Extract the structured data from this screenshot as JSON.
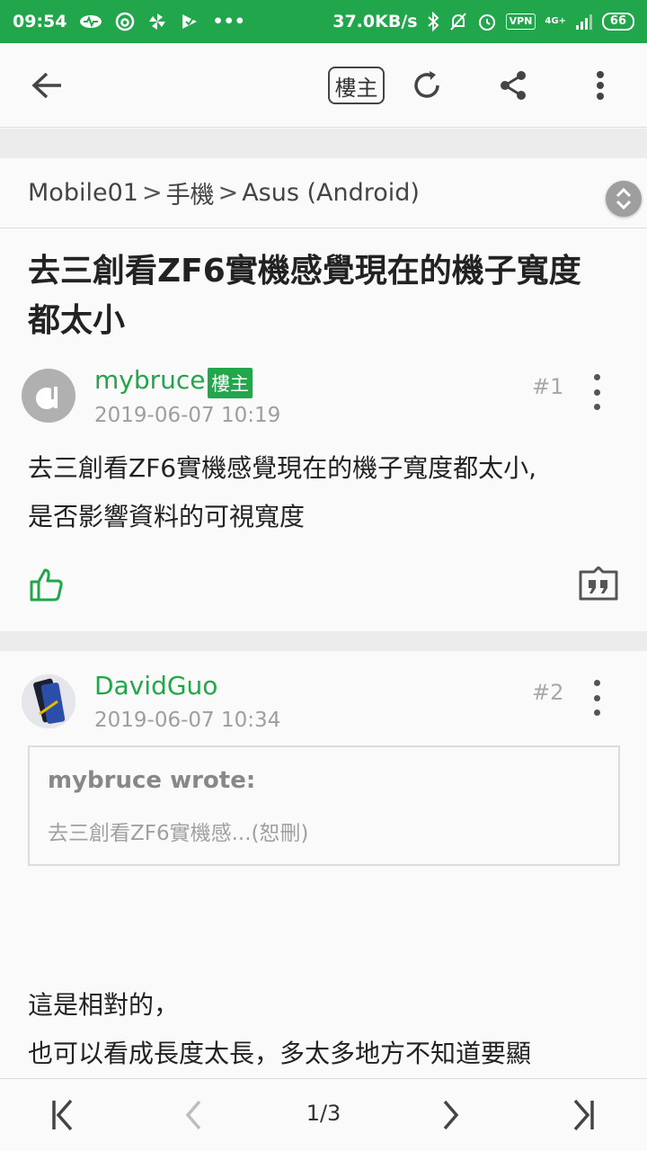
{
  "status_bar": {
    "time": "09:54",
    "more": "•••",
    "speed": "37.0KB/s",
    "vpn": "VPN",
    "network": "4G+",
    "battery": "66"
  },
  "app_bar": {
    "louzhu_label": "樓主"
  },
  "breadcrumb": [
    "Mobile01",
    "手機",
    "Asus (Android)"
  ],
  "breadcrumb_sep": ">",
  "thread": {
    "title": "去三創看ZF6實機感覺現在的機子寬度都太小"
  },
  "posts": [
    {
      "author": "mybruce",
      "badge": "樓主",
      "date": "2019-06-07 10:19",
      "floor": "#1",
      "body_line1": "去三創看ZF6實機感覺現在的機子寬度都太小,",
      "body_line2": "是否影響資料的可視寬度"
    },
    {
      "author": "DavidGuo",
      "date": "2019-06-07 10:34",
      "floor": "#2",
      "quote_title": "mybruce wrote:",
      "quote_body": "去三創看ZF6實機感...(恕刪)",
      "body_line1": "這是相對的，",
      "body_line2": "也可以看成長度太長，多太多地方不知道要顯"
    }
  ],
  "pager": {
    "indicator": "1/3"
  },
  "colors": {
    "accent": "#21a64b",
    "status_bar": "#21a64b"
  }
}
